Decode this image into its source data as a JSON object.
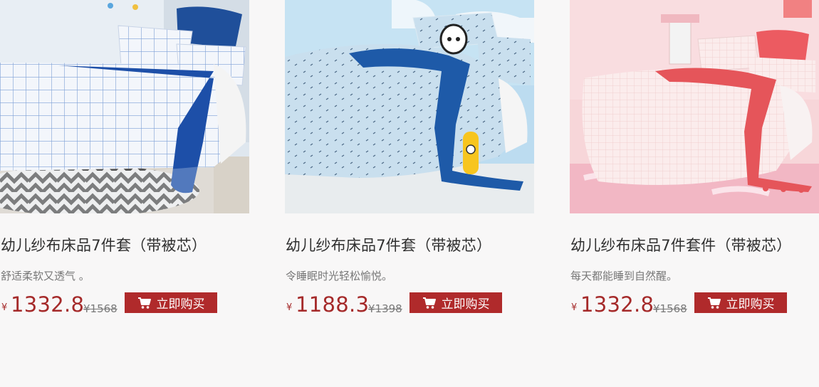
{
  "products": [
    {
      "image": "white blue-grid bedding set with blue throw blanket",
      "title": "幼儿纱布床品7件套（带被芯）",
      "description": "舒适柔软又透气 。",
      "currency": "¥",
      "price": "1332.8",
      "original_price": "¥1568",
      "buy_label": "立即购买",
      "accent": "#1d4fa8"
    },
    {
      "image": "light blue printed bedding set with blue throw and plush toys",
      "title": "幼儿纱布床品7件套（带被芯）",
      "description": "令睡眠时光轻松愉悦。",
      "currency": "¥",
      "price": "1188.3",
      "original_price": "¥1398",
      "buy_label": "立即购买",
      "accent": "#1e5aa8"
    },
    {
      "image": "pink grid bedding set with coral throw blanket",
      "title": "幼儿纱布床品7件套件（带被芯）",
      "description": "每天都能睡到自然醒。",
      "currency": "¥",
      "price": "1332.8",
      "original_price": "¥1568",
      "buy_label": "立即购买",
      "accent": "#e5555a"
    }
  ],
  "colors": {
    "price": "#a52a2a",
    "button": "#b02a2b",
    "page_background": "#f8f7f7"
  },
  "icons": {
    "button": "shopping-cart-icon"
  }
}
